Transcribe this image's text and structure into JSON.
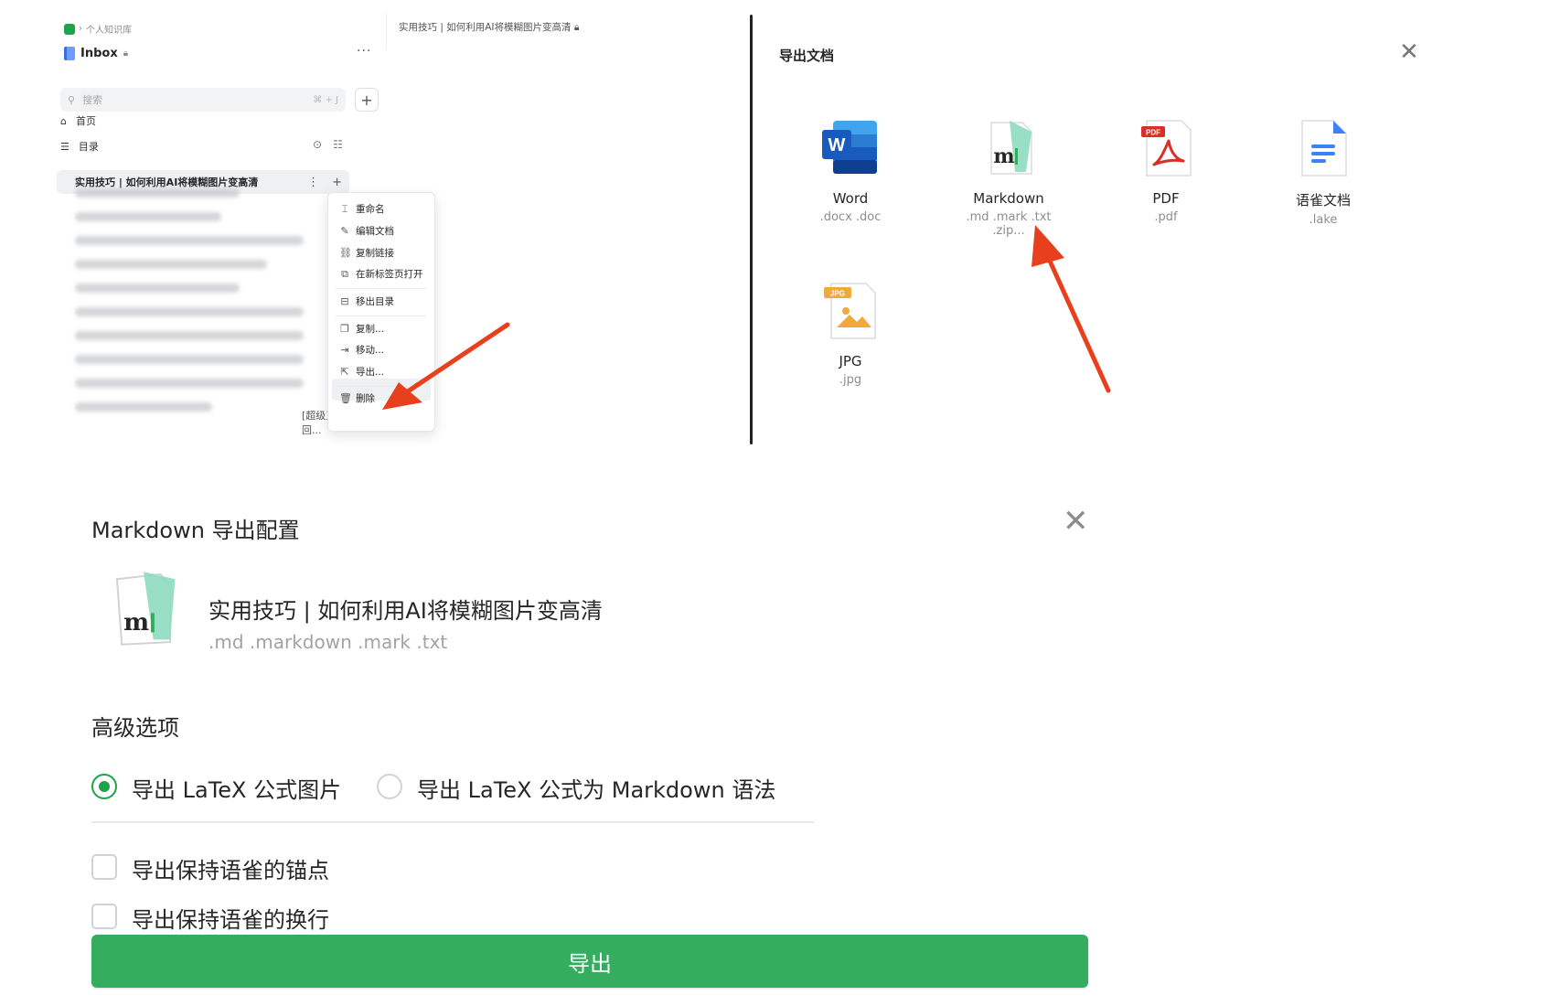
{
  "sidebar": {
    "breadcrumb": "个人知识库",
    "library_title": "Inbox",
    "search_placeholder": "搜索",
    "search_shortcut": "⌘ + J",
    "home_label": "首页",
    "toc_label": "目录",
    "active_doc": "实用技巧 | 如何利用AI将模糊图片变高清",
    "last_row_fragment": "[超级直播回..."
  },
  "context_menu": {
    "items": [
      "重命名",
      "编辑文档",
      "复制链接",
      "在新标签页打开",
      "移出目录",
      "复制...",
      "移动...",
      "导出...",
      "删除"
    ]
  },
  "document": {
    "title": "实用技巧 | 如何利用AI将模糊图片变高清"
  },
  "export_dialog": {
    "title": "导出文档",
    "formats": [
      {
        "name": "Word",
        "ext": ".docx .doc",
        "icon": "word-icon"
      },
      {
        "name": "Markdown",
        "ext": ".md .mark .txt .zip...",
        "icon": "markdown-icon"
      },
      {
        "name": "PDF",
        "ext": ".pdf",
        "icon": "pdf-icon"
      },
      {
        "name": "语雀文档",
        "ext": ".lake",
        "icon": "lake-doc-icon"
      },
      {
        "name": "JPG",
        "ext": ".jpg",
        "icon": "jpg-icon"
      }
    ]
  },
  "markdown_config": {
    "title": "Markdown 导出配置",
    "doc_name": "实用技巧 | 如何利用AI将模糊图片变高清",
    "doc_ext": ".md .markdown .mark .txt",
    "advanced_label": "高级选项",
    "radio_image_label": "导出 LaTeX 公式图片",
    "radio_markdown_label": "导出 LaTeX 公式为 Markdown 语法",
    "radio_selected": "image",
    "checkbox_anchor_label": "导出保持语雀的锚点",
    "checkbox_anchor_checked": false,
    "checkbox_linebreak_label": "导出保持语雀的换行",
    "checkbox_linebreak_checked": false,
    "export_button": "导出"
  },
  "colors": {
    "accent_green": "#35ad5f",
    "arrow_red": "#e8401c",
    "word_blue": "#2b5fcf",
    "pdf_red": "#d93025",
    "lake_blue": "#3b82f6",
    "jpg_orange": "#f2a93b"
  }
}
